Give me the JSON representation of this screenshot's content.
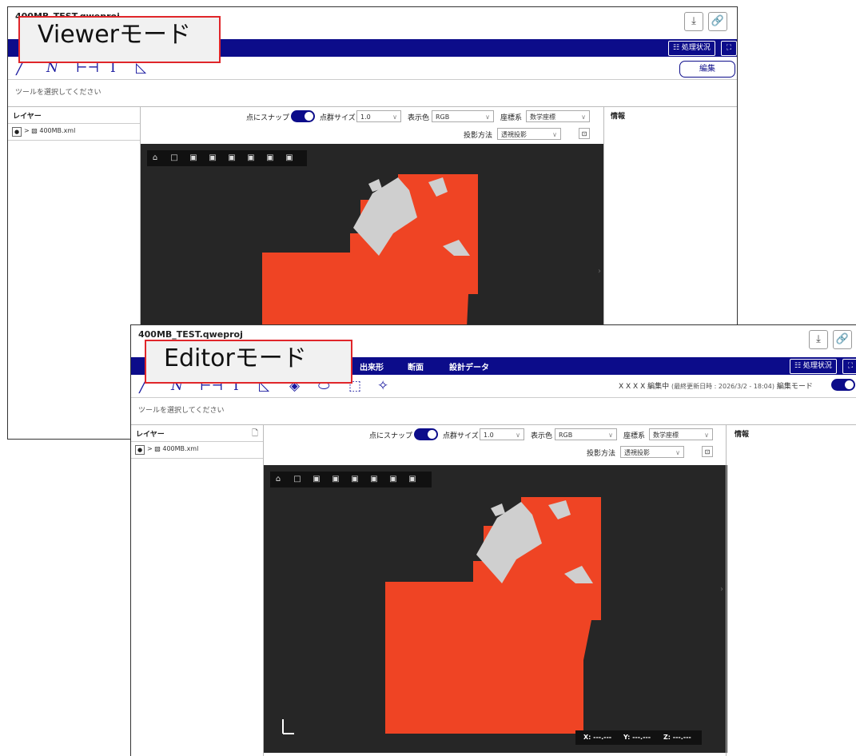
{
  "viewer": {
    "label": "Viewerモード",
    "project_title": "400MB_TEST.qweproj",
    "status_button": "☷ 処理状況",
    "edit_button": "編集",
    "tool_hint": "ツールを選択してください",
    "layer_panel_title": "レイヤー",
    "layer_name": "400MB.xml",
    "info_panel_title": "情報",
    "snap_label": "点にスナップ",
    "pointsize_label": "点群サイズ",
    "pointsize_value": "1.0",
    "color_label": "表示色",
    "color_value": "RGB",
    "coord_label": "座標系",
    "coord_value": "数学座標",
    "projection_label": "投影方法",
    "projection_value": "透視投影"
  },
  "editor": {
    "label": "Editorモード",
    "project_title": "400MB_TEST.qweproj",
    "menu": [
      "出来形",
      "断面",
      "設計データ"
    ],
    "status_button": "☷ 処理状況",
    "edit_user": "X X X X 編集中",
    "last_update": "(最終更新日時 : 2026/3/2 - 18:04)",
    "edit_mode_label": "編集モード",
    "tool_hint": "ツールを選択してください",
    "layer_panel_title": "レイヤー",
    "layer_name": "400MB.xml",
    "info_panel_title": "情報",
    "snap_label": "点にスナップ",
    "pointsize_label": "点群サイズ",
    "pointsize_value": "1.0",
    "color_label": "表示色",
    "color_value": "RGB",
    "coord_label": "座標系",
    "coord_value": "数学座標",
    "projection_label": "投影方法",
    "projection_value": "透視投影",
    "coord_x": "X: ---.---",
    "coord_y": "Y: ---.---",
    "coord_z": "Z: ---.---"
  },
  "colors": {
    "menubar": "#0c0c8a",
    "viewport_bg": "#262626",
    "pointcloud": "#ef4424",
    "label_border": "#e0262a"
  },
  "icons": [
    "download-icon",
    "link-icon",
    "fullscreen-icon",
    "home-icon",
    "view-cube-icon",
    "line-tool-icon",
    "polyline-tool-icon",
    "distance-tool-icon",
    "height-tool-icon",
    "area-tool-icon",
    "eye-icon",
    "new-layer-icon",
    "chevron-right-icon"
  ]
}
